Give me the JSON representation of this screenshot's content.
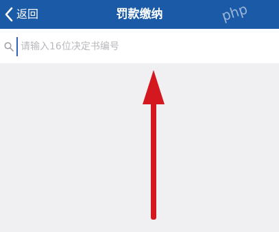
{
  "navbar": {
    "back_label": "返回",
    "title": "罚款缴纳",
    "watermark": "php",
    "color": "#1b5aa6"
  },
  "search": {
    "placeholder": "请输入16位决定书编号",
    "value": "",
    "icon": "search-icon"
  },
  "annotation": {
    "icon": "up-arrow-annotation",
    "color": "#d41820"
  }
}
